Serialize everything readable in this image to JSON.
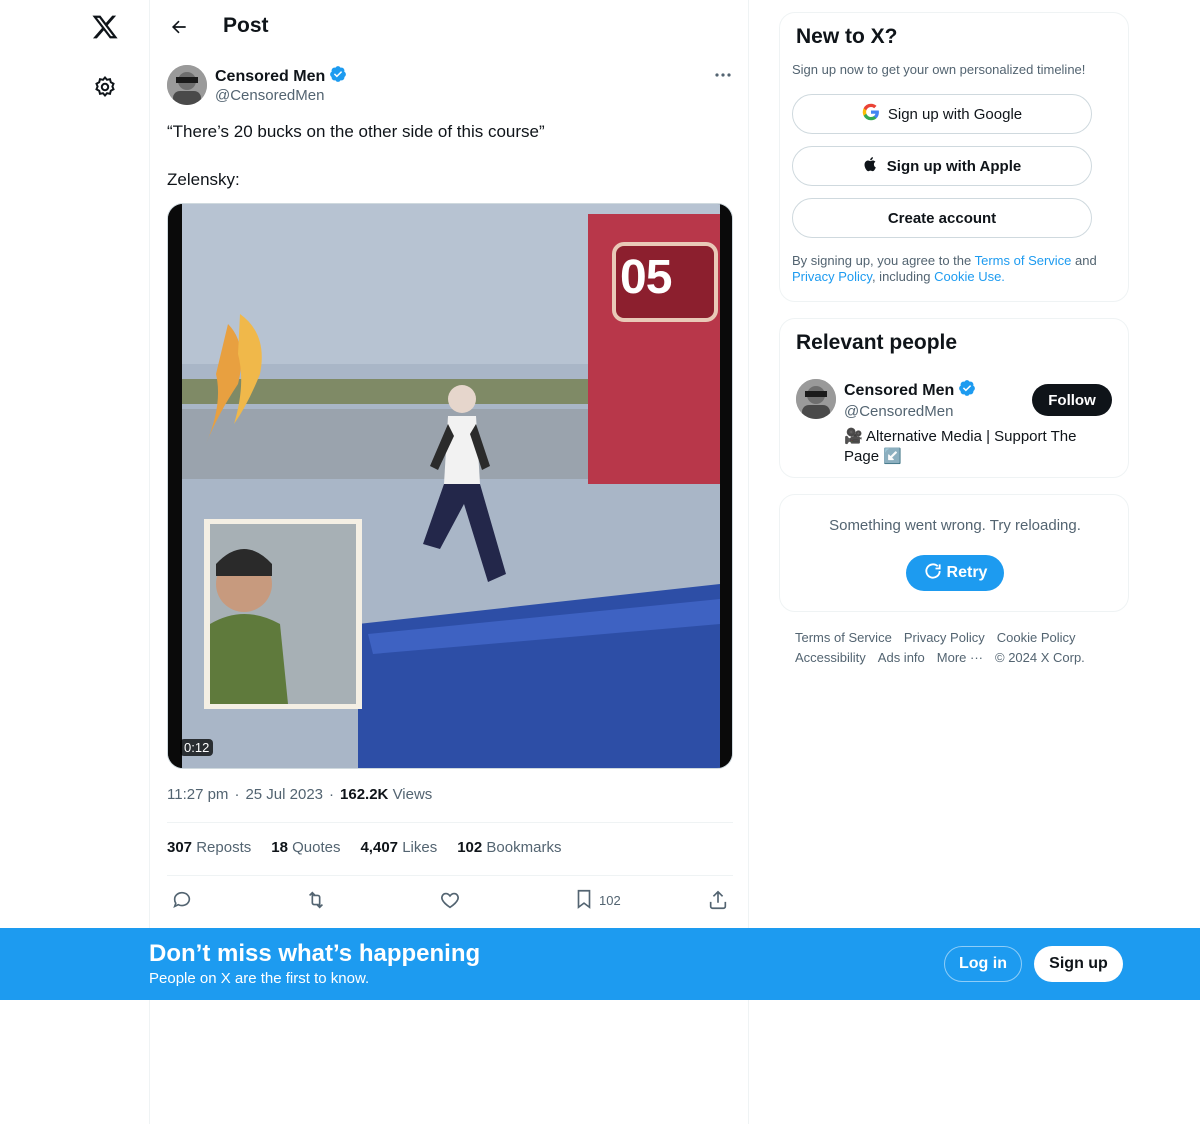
{
  "header": {
    "title": "Post"
  },
  "post": {
    "author_name": "Censored Men",
    "author_handle": "@CensoredMen",
    "text": "“There’s 20 bucks on the other side of this course”\n\nZelensky:",
    "video_duration": "0:12",
    "video_overlay_number": "05",
    "time": "11:27 pm",
    "date": "25 Jul 2023",
    "views_count": "162.2K",
    "views_label": "Views",
    "stats": [
      {
        "count": "307",
        "label": "Reposts"
      },
      {
        "count": "18",
        "label": "Quotes"
      },
      {
        "count": "4,407",
        "label": "Likes"
      },
      {
        "count": "102",
        "label": "Bookmarks"
      }
    ],
    "bookmark_count": "102"
  },
  "signup_card": {
    "title": "New to X?",
    "subtitle": "Sign up now to get your own personalized timeline!",
    "google_label": "Sign up with Google",
    "apple_label": "Sign up with Apple",
    "create_label": "Create account",
    "legal_prefix": "By signing up, you agree to the ",
    "terms": "Terms of Service",
    "legal_and": " and",
    "privacy": "Privacy Policy",
    "legal_including": ", including ",
    "cookie": "Cookie Use."
  },
  "relevant_people": {
    "title": "Relevant people",
    "name": "Censored Men",
    "handle": "@CensoredMen",
    "follow_label": "Follow",
    "bio": "🎥 Alternative Media | Support The Page ↙️"
  },
  "error_card": {
    "message": "Something went wrong. Try reloading.",
    "retry_label": "Retry"
  },
  "footer": {
    "links": [
      "Terms of Service",
      "Privacy Policy",
      "Cookie Policy",
      "Accessibility",
      "Ads info",
      "More ···",
      "© 2024 X Corp."
    ]
  },
  "banner": {
    "title": "Don’t miss what’s happening",
    "subtitle": "People on X are the first to know.",
    "login_label": "Log in",
    "signup_label": "Sign up"
  },
  "colors": {
    "accent": "#1d9bf0",
    "text": "#0f1419",
    "muted": "#536471",
    "verified": "#1d9bf0"
  }
}
